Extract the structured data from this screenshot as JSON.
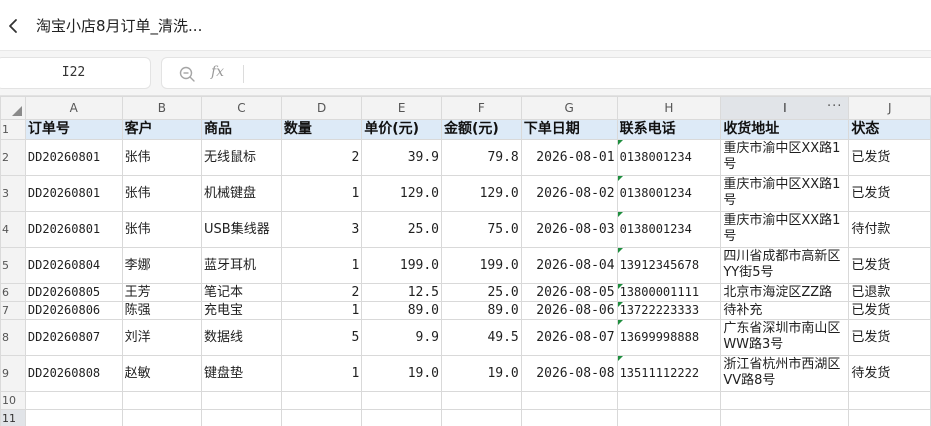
{
  "title_bar": {
    "title": "淘宝小店8月订单_清洗..."
  },
  "formula_bar": {
    "cell_ref": "I22",
    "fx_label": "fx",
    "formula_value": ""
  },
  "columns": [
    "A",
    "B",
    "C",
    "D",
    "E",
    "F",
    "G",
    "H",
    "I",
    "J"
  ],
  "selected_column": "I",
  "selected_row": "11",
  "header_row": {
    "row_num": "1",
    "cells": [
      "订单号",
      "客户",
      "商品",
      "数量",
      "单价(元)",
      "金额(元)",
      "下单日期",
      "联系电话",
      "收货地址",
      "状态"
    ]
  },
  "rows": [
    {
      "row_num": "2",
      "order_id": "DD20260801",
      "customer": "张伟",
      "product": "无线鼠标",
      "qty": "2",
      "price": "39.9",
      "amount": "79.8",
      "date": "2026-08-01",
      "phone": "0138001234",
      "address": "重庆市渝中区XX路1号",
      "status": "已发货"
    },
    {
      "row_num": "3",
      "order_id": "DD20260801",
      "customer": "张伟",
      "product": "机械键盘",
      "qty": "1",
      "price": "129.0",
      "amount": "129.0",
      "date": "2026-08-02",
      "phone": "0138001234",
      "address": "重庆市渝中区XX路1号",
      "status": "已发货"
    },
    {
      "row_num": "4",
      "order_id": "DD20260801",
      "customer": "张伟",
      "product": "USB集线器",
      "qty": "3",
      "price": "25.0",
      "amount": "75.0",
      "date": "2026-08-03",
      "phone": "0138001234",
      "address": "重庆市渝中区XX路1号",
      "status": "待付款"
    },
    {
      "row_num": "5",
      "order_id": "DD20260804",
      "customer": "李娜",
      "product": "蓝牙耳机",
      "qty": "1",
      "price": "199.0",
      "amount": "199.0",
      "date": "2026-08-04",
      "phone": "13912345678",
      "address": "四川省成都市高新区YY街5号",
      "status": "已发货"
    },
    {
      "row_num": "6",
      "order_id": "DD20260805",
      "customer": "王芳",
      "product": "笔记本",
      "qty": "2",
      "price": "12.5",
      "amount": "25.0",
      "date": "2026-08-05",
      "phone": "13800001111",
      "address": "北京市海淀区ZZ路",
      "status": "已退款"
    },
    {
      "row_num": "7",
      "order_id": "DD20260806",
      "customer": "陈强",
      "product": "充电宝",
      "qty": "1",
      "price": "89.0",
      "amount": "89.0",
      "date": "2026-08-06",
      "phone": "13722223333",
      "address": "待补充",
      "status": "已发货"
    },
    {
      "row_num": "8",
      "order_id": "DD20260807",
      "customer": "刘洋",
      "product": "数据线",
      "qty": "5",
      "price": "9.9",
      "amount": "49.5",
      "date": "2026-08-07",
      "phone": "13699998888",
      "address": "广东省深圳市南山区WW路3号",
      "status": "已发货"
    },
    {
      "row_num": "9",
      "order_id": "DD20260808",
      "customer": "赵敏",
      "product": "键盘垫",
      "qty": "1",
      "price": "19.0",
      "amount": "19.0",
      "date": "2026-08-08",
      "phone": "13511112222",
      "address": "浙江省杭州市西湖区VV路8号",
      "status": "待发货"
    }
  ],
  "empty_rows": [
    "10",
    "11"
  ],
  "colors": {
    "header_fill": "#ddeaf7",
    "selected_header": "#e1e4e8",
    "number_stored_as_text_marker": "#1e8e3e"
  }
}
